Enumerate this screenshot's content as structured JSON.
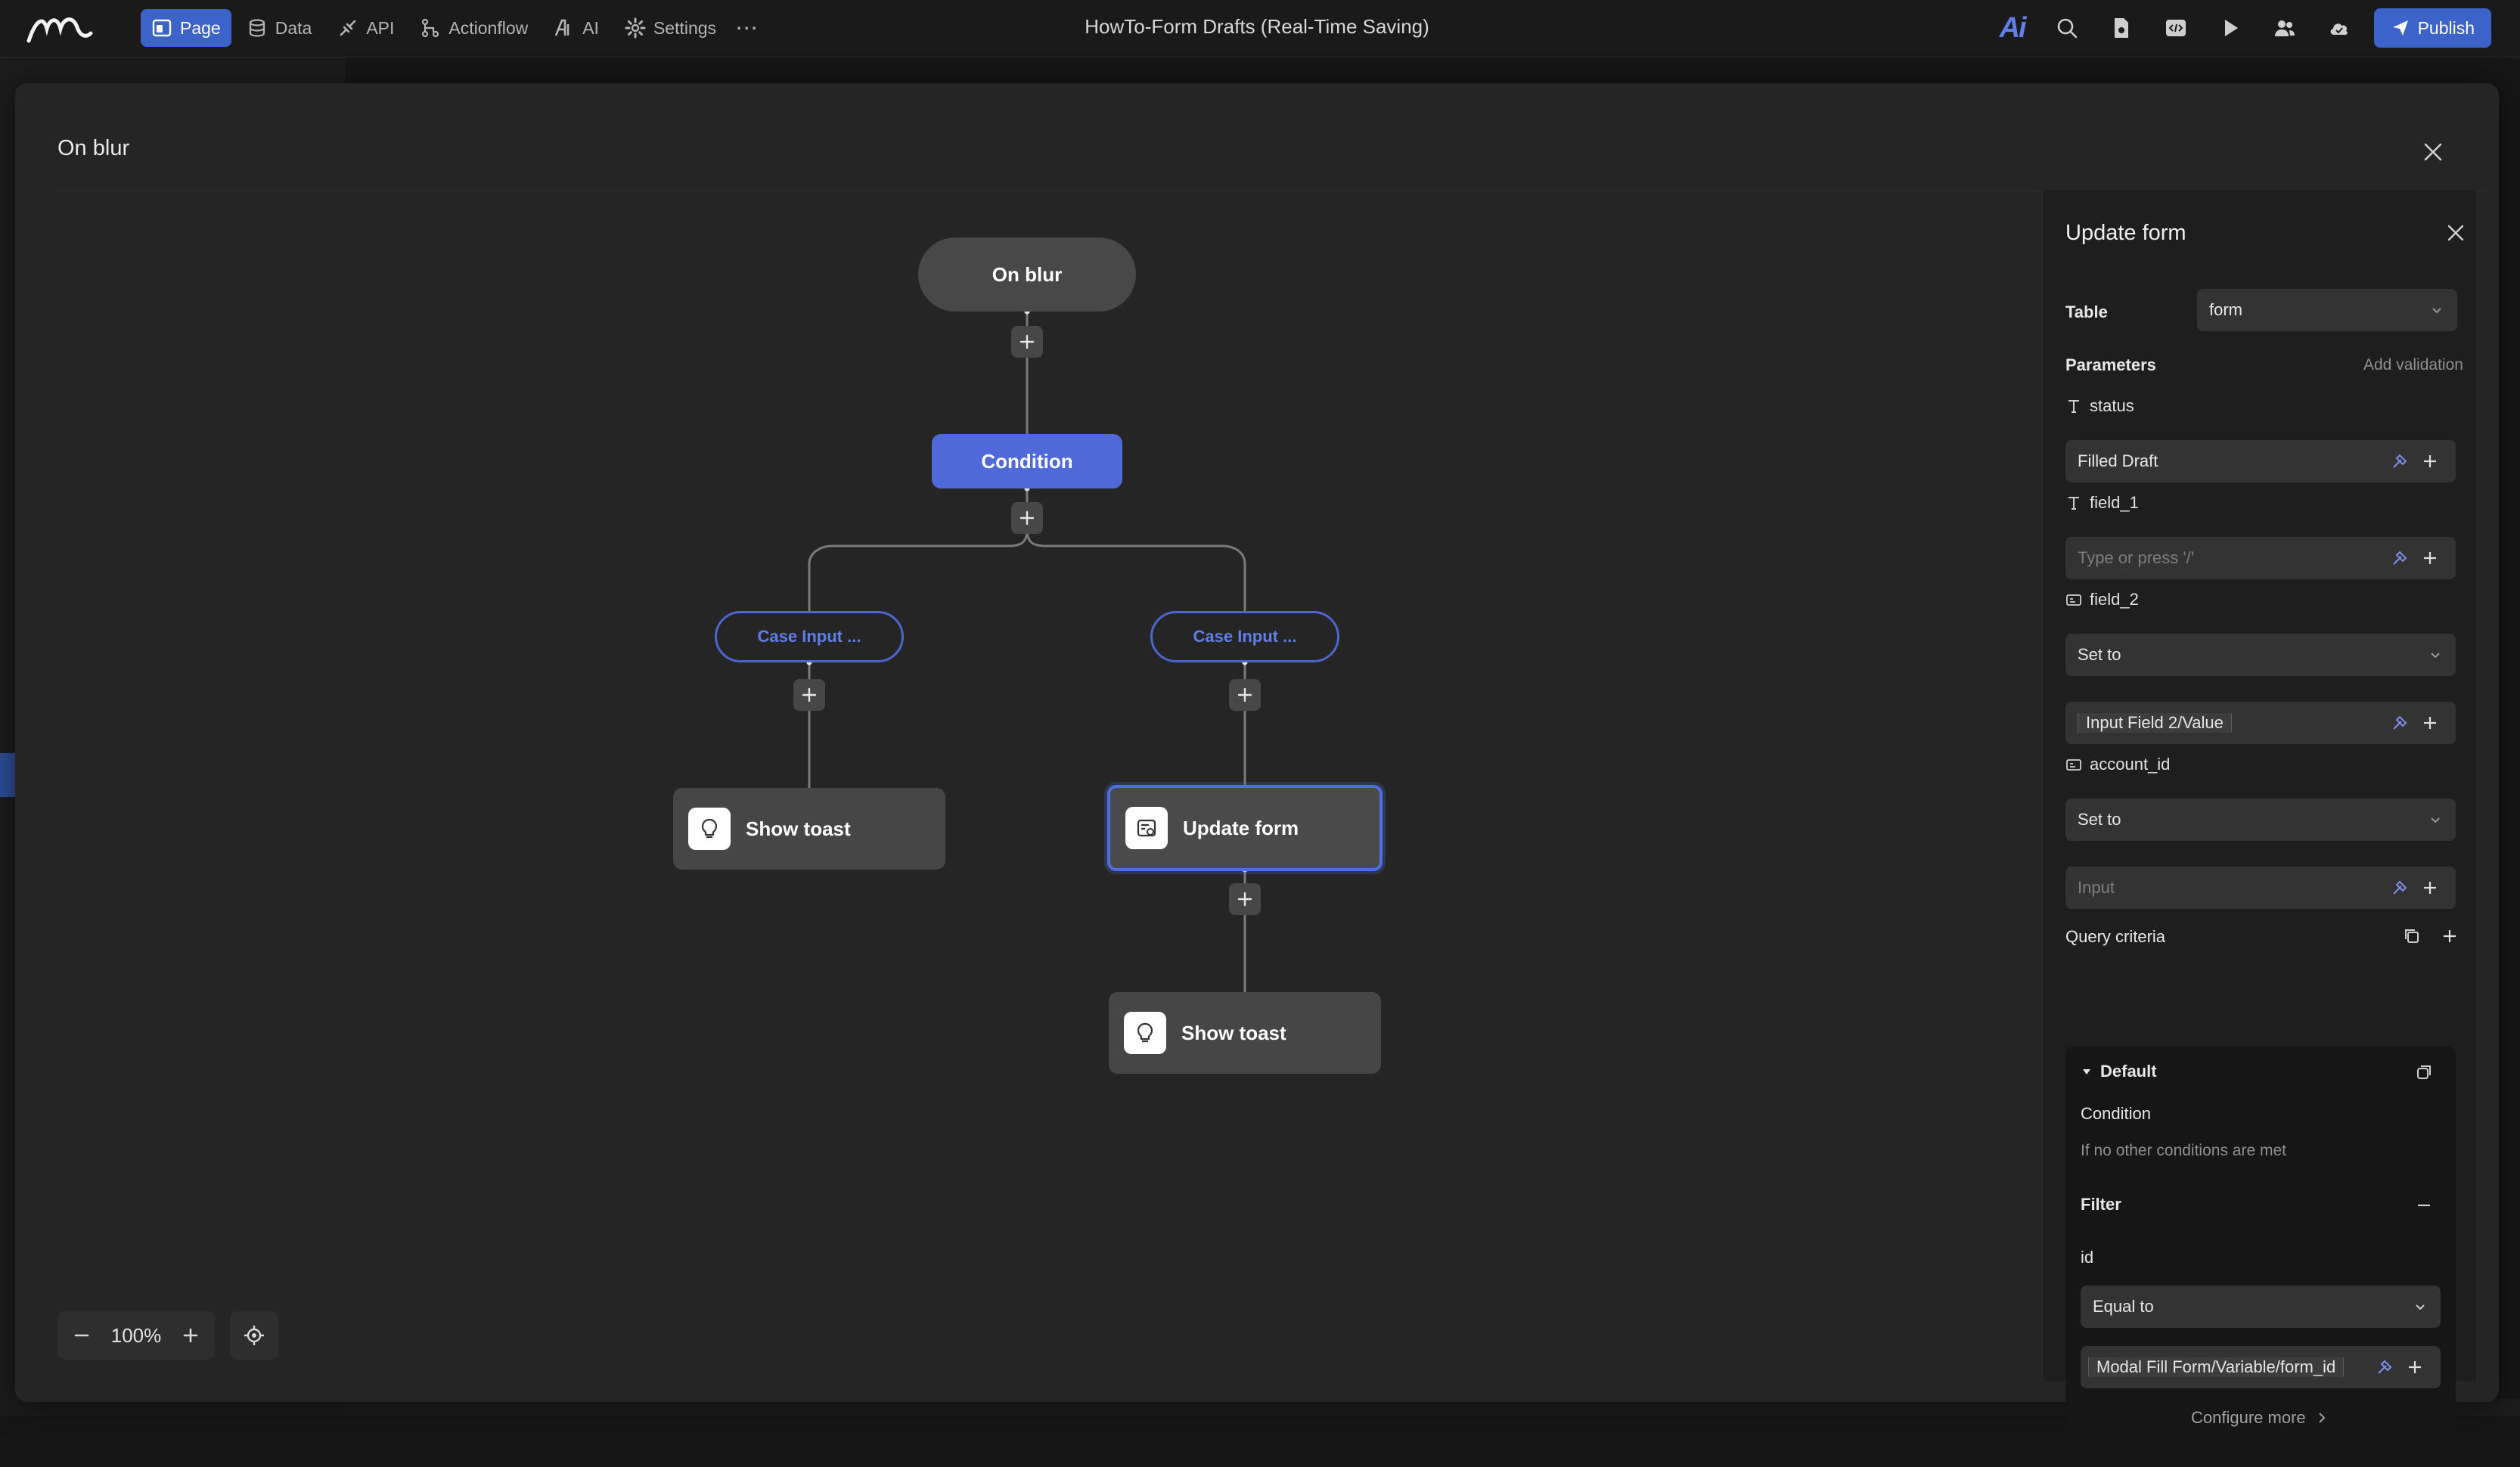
{
  "header": {
    "title": "HowTo-Form Drafts (Real-Time Saving)",
    "nav": [
      {
        "label": "Page",
        "icon": "page-icon",
        "active": true
      },
      {
        "label": "Data",
        "icon": "database-icon",
        "active": false
      },
      {
        "label": "API",
        "icon": "api-icon",
        "active": false
      },
      {
        "label": "Actionflow",
        "icon": "actionflow-icon",
        "active": false
      },
      {
        "label": "AI",
        "icon": "ai-icon",
        "active": false
      },
      {
        "label": "Settings",
        "icon": "gear-icon",
        "active": false
      }
    ],
    "more": "⋯",
    "ai_logo": "Ai",
    "publish_label": "Publish"
  },
  "modal": {
    "title": "On blur"
  },
  "flow": {
    "start": "On blur",
    "condition": "Condition",
    "case_left": "Case Input ...",
    "case_right": "Case Input ...",
    "left_action": "Show toast",
    "right_action": "Update form",
    "bottom_action": "Show toast"
  },
  "zoom": {
    "value": "100%"
  },
  "panel": {
    "title": "Update form",
    "table_label": "Table",
    "table_value": "form",
    "parameters_label": "Parameters",
    "add_validation": "Add validation",
    "params": {
      "status": {
        "name": "status",
        "value": "Filled Draft"
      },
      "field_1": {
        "name": "field_1",
        "placeholder": "Type or press '/'"
      },
      "field_2": {
        "name": "field_2",
        "mode": "Set to",
        "value": "Input Field 2/Value"
      },
      "account_id": {
        "name": "account_id",
        "mode": "Set to",
        "placeholder": "Input"
      }
    },
    "query_criteria_label": "Query criteria",
    "default_label": "Default",
    "condition_label": "Condition",
    "condition_text": "If no other conditions are met",
    "filter_label": "Filter",
    "filter_field": "id",
    "filter_operator": "Equal to",
    "filter_value": "Modal Fill Form/Variable/form_id",
    "configure_more": "Configure more"
  },
  "colors": {
    "accent": "#4f6ad8",
    "publish": "#3b63c9",
    "canvas": "#252525",
    "panel": "#1e1e1e"
  }
}
